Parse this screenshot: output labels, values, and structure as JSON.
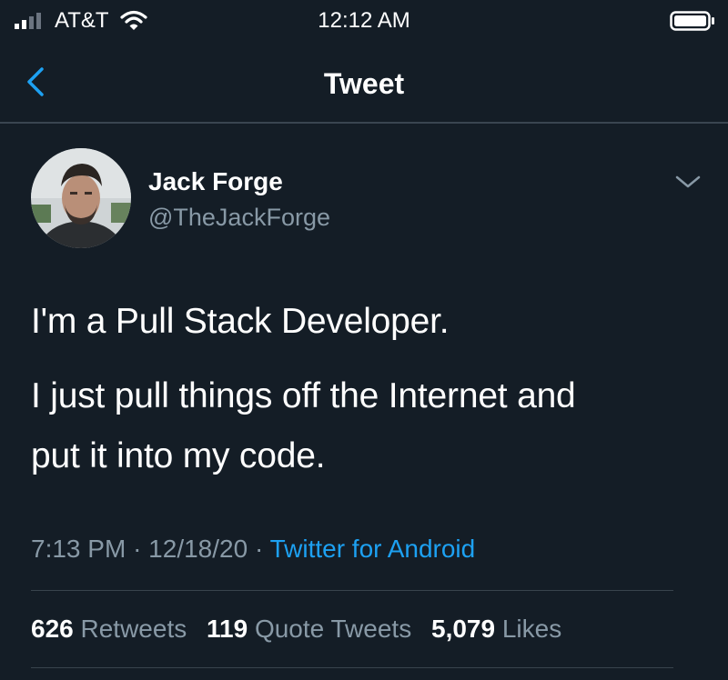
{
  "status_bar": {
    "carrier": "AT&T",
    "time": "12:12 AM"
  },
  "nav": {
    "title": "Tweet"
  },
  "tweet": {
    "author_name": "Jack Forge",
    "author_handle": "@TheJackForge",
    "lines": [
      "I'm a Pull Stack Developer.",
      "I just pull things off the Internet and",
      "put it into my code."
    ],
    "time": "7:13 PM",
    "separator": "·",
    "date": "12/18/20",
    "source": "Twitter for Android"
  },
  "stats": {
    "retweets_count": "626",
    "retweets_label": "Retweets",
    "quote_tweets_count": "119",
    "quote_tweets_label": "Quote Tweets",
    "likes_count": "5,079",
    "likes_label": "Likes"
  },
  "colors": {
    "background": "#141d26",
    "accent": "#1da1f2",
    "secondary_text": "#8899a6"
  }
}
